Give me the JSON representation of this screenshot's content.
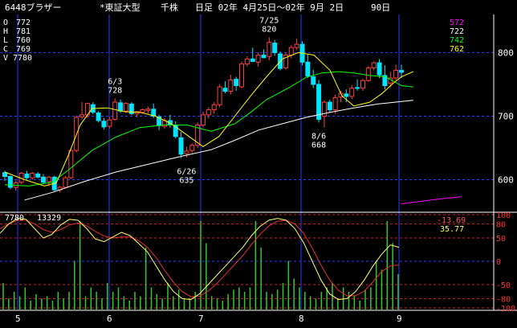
{
  "header": {
    "code_name": "6448ブラザー",
    "market": "*東証大型",
    "unit": "千株",
    "period": "日足 02年 4月25日～02年 9月 2日",
    "days": "90日"
  },
  "ohlcv": [
    {
      "key": "O",
      "value": "772"
    },
    {
      "key": "H",
      "value": "781"
    },
    {
      "key": "L",
      "value": "760"
    },
    {
      "key": "C",
      "value": "769"
    },
    {
      "key": "V",
      "value": "7780"
    }
  ],
  "moving_averages": [
    {
      "value": "572",
      "color": "#ff00ff"
    },
    {
      "value": "722",
      "color": "#ffffff"
    },
    {
      "value": "742",
      "color": "#00ff00"
    },
    {
      "value": "762",
      "color": "#ffff00"
    }
  ],
  "colors": {
    "up_candle": "#ff4040",
    "down_candle": "#00e5ff",
    "grid": "#2a3cff",
    "axis_text": "#ffffff",
    "osc_fast": "#ffff66",
    "osc_slow": "#e83030",
    "volume": "#2ec82e"
  },
  "chart_data": {
    "type": "candlestick",
    "ylim": [
      550,
      860
    ],
    "y_ticks": [
      600,
      700,
      800
    ],
    "x_ticks": [
      "5",
      "6",
      "7",
      "8",
      "9"
    ],
    "candles": [
      [
        611,
        614,
        598,
        605
      ],
      [
        605,
        607,
        585,
        588
      ],
      [
        588,
        598,
        583,
        595
      ],
      [
        596,
        612,
        593,
        610
      ],
      [
        609,
        614,
        600,
        603
      ],
      [
        603,
        612,
        600,
        610
      ],
      [
        609,
        612,
        602,
        604
      ],
      [
        604,
        609,
        593,
        596
      ],
      [
        597,
        606,
        590,
        604
      ],
      [
        604,
        606,
        582,
        584
      ],
      [
        584,
        590,
        580,
        588
      ],
      [
        588,
        606,
        586,
        603
      ],
      [
        603,
        648,
        601,
        646
      ],
      [
        646,
        701,
        643,
        698
      ],
      [
        699,
        722,
        695,
        702
      ],
      [
        702,
        721,
        697,
        720
      ],
      [
        718,
        722,
        703,
        706
      ],
      [
        705,
        708,
        690,
        693
      ],
      [
        692,
        697,
        679,
        683
      ],
      [
        684,
        699,
        680,
        694
      ],
      [
        695,
        728,
        693,
        722
      ],
      [
        721,
        726,
        705,
        708
      ],
      [
        708,
        722,
        705,
        720
      ],
      [
        719,
        722,
        702,
        704
      ],
      [
        704,
        708,
        698,
        707
      ],
      [
        706,
        712,
        704,
        710
      ],
      [
        709,
        715,
        704,
        711
      ],
      [
        711,
        720,
        697,
        700
      ],
      [
        699,
        702,
        678,
        685
      ],
      [
        684,
        697,
        680,
        693
      ],
      [
        693,
        702,
        682,
        686
      ],
      [
        686,
        692,
        665,
        668
      ],
      [
        666,
        675,
        634,
        640
      ],
      [
        641,
        652,
        635,
        645
      ],
      [
        646,
        657,
        642,
        654
      ],
      [
        654,
        690,
        650,
        686
      ],
      [
        686,
        707,
        682,
        702
      ],
      [
        702,
        714,
        696,
        710
      ],
      [
        710,
        722,
        704,
        718
      ],
      [
        718,
        750,
        714,
        746
      ],
      [
        744,
        755,
        736,
        739
      ],
      [
        739,
        765,
        734,
        757
      ],
      [
        758,
        762,
        740,
        748
      ],
      [
        746,
        786,
        744,
        782
      ],
      [
        782,
        794,
        778,
        790
      ],
      [
        790,
        808,
        785,
        786
      ],
      [
        785,
        800,
        778,
        796
      ],
      [
        796,
        805,
        791,
        792
      ],
      [
        794,
        824,
        788,
        816
      ],
      [
        815,
        820,
        795,
        800
      ],
      [
        798,
        802,
        772,
        775
      ],
      [
        776,
        800,
        773,
        796
      ],
      [
        796,
        812,
        791,
        808
      ],
      [
        808,
        822,
        804,
        813
      ],
      [
        813,
        818,
        780,
        785
      ],
      [
        785,
        797,
        760,
        763
      ],
      [
        762,
        773,
        744,
        750
      ],
      [
        750,
        757,
        690,
        695
      ],
      [
        700,
        725,
        682,
        722
      ],
      [
        722,
        726,
        705,
        710
      ],
      [
        710,
        734,
        704,
        729
      ],
      [
        730,
        740,
        722,
        736
      ],
      [
        735,
        742,
        722,
        731
      ],
      [
        731,
        749,
        727,
        744
      ],
      [
        745,
        758,
        740,
        744
      ],
      [
        744,
        759,
        740,
        756
      ],
      [
        756,
        779,
        754,
        776
      ],
      [
        776,
        786,
        772,
        784
      ],
      [
        784,
        790,
        760,
        765
      ],
      [
        764,
        780,
        742,
        748
      ],
      [
        752,
        770,
        745,
        760
      ],
      [
        760,
        781,
        756,
        772
      ],
      [
        772,
        781,
        760,
        769
      ]
    ],
    "ma_lines": [
      {
        "name": "572",
        "color": "#ff00ff",
        "points": [
          [
            1.0,
            562
          ],
          [
            1.05,
            566
          ],
          [
            1.1,
            570
          ],
          [
            1.15,
            573
          ]
        ]
      },
      {
        "name": "722",
        "color": "#ffffff",
        "points": [
          [
            0.05,
            568
          ],
          [
            0.12,
            580
          ],
          [
            0.2,
            597
          ],
          [
            0.28,
            612
          ],
          [
            0.36,
            624
          ],
          [
            0.44,
            636
          ],
          [
            0.52,
            647
          ],
          [
            0.58,
            662
          ],
          [
            0.64,
            678
          ],
          [
            0.7,
            688
          ],
          [
            0.76,
            698
          ],
          [
            0.82,
            706
          ],
          [
            0.88,
            713
          ],
          [
            0.94,
            719
          ],
          [
            1.0,
            723
          ],
          [
            1.03,
            725
          ]
        ]
      },
      {
        "name": "742",
        "color": "#00ff00",
        "points": [
          [
            0.0,
            592
          ],
          [
            0.06,
            590
          ],
          [
            0.12,
            596
          ],
          [
            0.16,
            615
          ],
          [
            0.22,
            646
          ],
          [
            0.28,
            667
          ],
          [
            0.34,
            682
          ],
          [
            0.4,
            686
          ],
          [
            0.46,
            686
          ],
          [
            0.52,
            676
          ],
          [
            0.58,
            688
          ],
          [
            0.62,
            706
          ],
          [
            0.66,
            726
          ],
          [
            0.72,
            746
          ],
          [
            0.76,
            761
          ],
          [
            0.8,
            768
          ],
          [
            0.84,
            770
          ],
          [
            0.88,
            768
          ],
          [
            0.92,
            764
          ],
          [
            0.96,
            762
          ],
          [
            1.0,
            748
          ],
          [
            1.03,
            746
          ]
        ]
      },
      {
        "name": "762",
        "color": "#ffff00",
        "points": [
          [
            0.0,
            612
          ],
          [
            0.05,
            600
          ],
          [
            0.1,
            590
          ],
          [
            0.13,
            595
          ],
          [
            0.16,
            638
          ],
          [
            0.19,
            686
          ],
          [
            0.22,
            712
          ],
          [
            0.26,
            713
          ],
          [
            0.3,
            707
          ],
          [
            0.34,
            706
          ],
          [
            0.38,
            700
          ],
          [
            0.42,
            688
          ],
          [
            0.46,
            670
          ],
          [
            0.5,
            652
          ],
          [
            0.54,
            668
          ],
          [
            0.58,
            700
          ],
          [
            0.62,
            732
          ],
          [
            0.66,
            762
          ],
          [
            0.7,
            790
          ],
          [
            0.74,
            800
          ],
          [
            0.78,
            796
          ],
          [
            0.82,
            772
          ],
          [
            0.85,
            732
          ],
          [
            0.88,
            716
          ],
          [
            0.92,
            722
          ],
          [
            0.95,
            735
          ],
          [
            0.98,
            752
          ],
          [
            1.0,
            762
          ],
          [
            1.03,
            770
          ]
        ]
      }
    ],
    "annotations": [
      {
        "text": "6/3",
        "value": 728,
        "index": 20,
        "position": "above"
      },
      {
        "text": "728",
        "value": 728,
        "index": 20,
        "position": "above2"
      },
      {
        "text": "7/25",
        "value": 824,
        "index": 48,
        "position": "above"
      },
      {
        "text": "820",
        "value": 824,
        "index": 48,
        "position": "above2"
      },
      {
        "text": "6/26",
        "value": 634,
        "index": 33,
        "position": "below"
      },
      {
        "text": "635",
        "value": 634,
        "index": 33,
        "position": "below2"
      },
      {
        "text": "8/6",
        "value": 690,
        "index": 57,
        "position": "below"
      },
      {
        "text": "668",
        "value": 690,
        "index": 57,
        "position": "below2"
      }
    ],
    "oscillator": {
      "ylim": [
        -100,
        100
      ],
      "y_ticks": [
        "100",
        "80",
        "50",
        "0",
        "-50",
        "-80",
        "-100"
      ],
      "readout_slow": "-13.69",
      "readout_fast": "35.77",
      "fast": [
        60,
        80,
        92,
        90,
        70,
        50,
        58,
        78,
        90,
        88,
        70,
        48,
        42,
        52,
        62,
        55,
        38,
        20,
        -10,
        -40,
        -65,
        -80,
        -82,
        -70,
        -50,
        -30,
        -10,
        10,
        30,
        55,
        75,
        88,
        92,
        88,
        70,
        40,
        0,
        -40,
        -70,
        -82,
        -80,
        -65,
        -40,
        -10,
        15,
        35,
        30
      ],
      "slow": [
        70,
        80,
        88,
        88,
        80,
        68,
        62,
        68,
        78,
        82,
        76,
        64,
        54,
        50,
        52,
        52,
        44,
        30,
        8,
        -20,
        -45,
        -65,
        -76,
        -75,
        -64,
        -48,
        -28,
        -8,
        12,
        36,
        58,
        76,
        86,
        88,
        80,
        60,
        28,
        -8,
        -40,
        -62,
        -74,
        -74,
        -64,
        -44,
        -22,
        -10,
        -8
      ],
      "volume": [
        12,
        5,
        8,
        6,
        10,
        4,
        7,
        5,
        6,
        4,
        8,
        5,
        8,
        22,
        40,
        6,
        10,
        8,
        5,
        12,
        8,
        10,
        6,
        4,
        8,
        6,
        28,
        10,
        7,
        5,
        12,
        6,
        9,
        5,
        5,
        8,
        40,
        30,
        6,
        5,
        4,
        7,
        9,
        10,
        8,
        10,
        40,
        28,
        8,
        7,
        9,
        12,
        22,
        14,
        10,
        8,
        6,
        5,
        8,
        10,
        12,
        5,
        10,
        8,
        6,
        4,
        9,
        10,
        22,
        18,
        40,
        30,
        16
      ]
    },
    "volume_label": "7780",
    "volume_max_label": "13329"
  }
}
